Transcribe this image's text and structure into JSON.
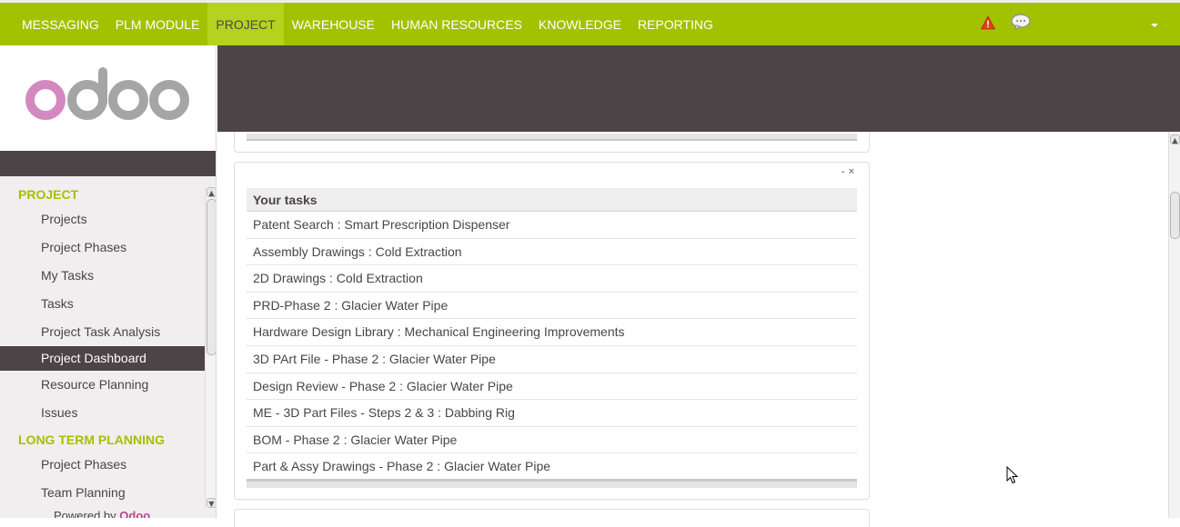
{
  "topbar": {
    "menu": [
      {
        "label": "MESSAGING",
        "active": false
      },
      {
        "label": "PLM MODULE",
        "active": false
      },
      {
        "label": "PROJECT",
        "active": true
      },
      {
        "label": "WAREHOUSE",
        "active": false
      },
      {
        "label": "HUMAN RESOURCES",
        "active": false
      },
      {
        "label": "KNOWLEDGE",
        "active": false
      },
      {
        "label": "REPORTING",
        "active": false
      }
    ],
    "icons": {
      "alert": "warning-triangle-icon",
      "chat": "chat-bubble-icon",
      "dropdown": "chevron-down-icon"
    },
    "bg_color": "#a2c200",
    "active_color": "#b4d21e"
  },
  "sidebar": {
    "logo_text": "odoo",
    "sections": [
      {
        "title": "PROJECT",
        "items": [
          {
            "label": "Projects",
            "active": false
          },
          {
            "label": "Project Phases",
            "active": false
          },
          {
            "label": "My Tasks",
            "active": false
          },
          {
            "label": "Tasks",
            "active": false
          },
          {
            "label": "Project Task Analysis",
            "active": false
          },
          {
            "label": "Project Dashboard",
            "active": true
          },
          {
            "label": "Resource Planning",
            "active": false
          },
          {
            "label": "Issues",
            "active": false
          }
        ]
      },
      {
        "title": "LONG TERM PLANNING",
        "items": [
          {
            "label": "Project Phases",
            "active": false
          },
          {
            "label": "Team Planning",
            "active": false
          }
        ]
      }
    ],
    "footer": {
      "prefix": "Powered by",
      "brand": "Odoo"
    }
  },
  "dashboard": {
    "tasks_panel": {
      "title": "Your tasks",
      "controls": {
        "minimize": "-",
        "close": "×"
      },
      "tasks": [
        "Patent Search : Smart Prescription Dispenser",
        "Assembly Drawings : Cold Extraction",
        "2D Drawings : Cold Extraction",
        "PRD-Phase 2 : Glacier Water Pipe",
        "Hardware Design Library : Mechanical Engineering Improvements",
        "3D PArt File - Phase 2 : Glacier Water Pipe",
        "Design Review - Phase 2 : Glacier Water Pipe",
        "ME - 3D Part Files - Steps 2 & 3 : Dabbing Rig",
        "BOM - Phase 2 : Glacier Water Pipe",
        "Part & Assy Drawings - Phase 2 : Glacier Water Pipe"
      ]
    }
  },
  "colors": {
    "dark": "#4c4446",
    "accent": "#a2c200",
    "brand_pink": "#b34a8e"
  }
}
